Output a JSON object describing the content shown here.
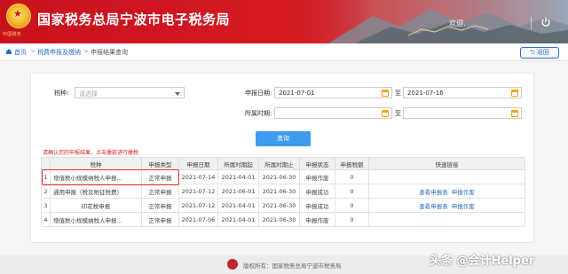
{
  "header": {
    "site_title": "国家税务总局宁波市电子税务局",
    "emblem_text": "中国税务",
    "welcome": "欢迎,"
  },
  "breadcrumb": {
    "home": "首页",
    "sep": ">",
    "section": "税费申报及缴纳",
    "current": "申报结果查询",
    "back": "返回"
  },
  "form": {
    "tax_label": "税种:",
    "tax_placeholder": "请选择",
    "decl_date_label": "申报日期:",
    "decl_date_from": "2021-07-01",
    "decl_date_to": "2021-07-16",
    "to_label": "至",
    "period_label": "所属时期:",
    "period_from": "",
    "period_to": "",
    "query_button": "查询"
  },
  "hint": "请确认您的申报结果，点击缴款进行缴税",
  "table": {
    "headers": [
      "",
      "税种",
      "申报类型",
      "申报日期",
      "所属时期起",
      "所属时期止",
      "申报状态",
      "申报税额",
      "快速链接"
    ],
    "rows": [
      {
        "no": "1",
        "tax": "增值税小规模纳税人申报...",
        "type": "正常申报",
        "date": "2021-07-14",
        "start": "2021-04-01",
        "end": "2021-06-30",
        "status": "申报作废",
        "amount": "0",
        "links": []
      },
      {
        "no": "2",
        "tax": "通用申报（税及附征税费）",
        "type": "正常申报",
        "date": "2021-07-12",
        "start": "2021-06-01",
        "end": "2021-06-30",
        "status": "申报成功",
        "amount": "0",
        "links": [
          "查看申报表",
          "申报作废"
        ]
      },
      {
        "no": "3",
        "tax": "印花税申报",
        "type": "正常申报",
        "date": "2021-07-12",
        "start": "2021-04-01",
        "end": "2021-06-30",
        "status": "申报成功",
        "amount": "0",
        "links": [
          "查看申报表",
          "申报作废"
        ]
      },
      {
        "no": "4",
        "tax": "增值税小规模纳税人申报...",
        "type": "正常申报",
        "date": "2021-07-06",
        "start": "2021-04-01",
        "end": "2021-06-30",
        "status": "申报作废",
        "amount": "0",
        "links": []
      }
    ]
  },
  "footer": "版权所有：国家税务总局宁波市税务局",
  "watermark": "头条 @会计Helper",
  "colors": {
    "header_red": "#c8121e",
    "link_blue": "#2a6ec4",
    "button_blue": "#3d9bf0",
    "hint_red": "#e02020"
  }
}
